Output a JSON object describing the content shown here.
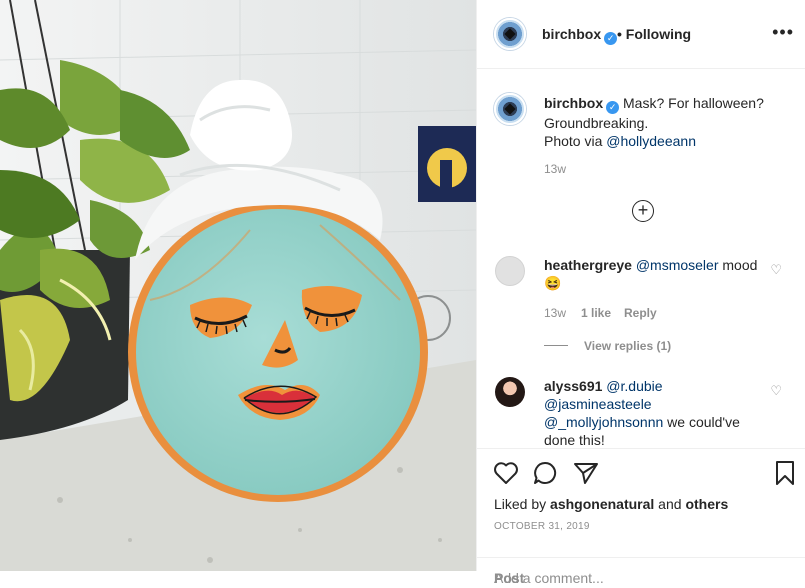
{
  "post": {
    "account": "birchbox",
    "verified_badge": "✓",
    "follow_status": "• Following",
    "more_icon": "more-horizontal-icon",
    "caption_username": "birchbox",
    "caption_text": "Mask? For halloween? Groundbreaking.",
    "caption_credit_prefix": "Photo via ",
    "caption_mention": "@hollydeeann",
    "caption_time": "13w",
    "load_more_icon": "plus-circle-icon",
    "likes_prefix": "Liked by ",
    "likes_user": "ashgonenatural",
    "likes_and": " and ",
    "likes_others": "others",
    "date": "OCTOBER 31, 2019",
    "comment_placeholder": "Add a comment...",
    "post_label": "Post"
  },
  "comments": [
    {
      "username": "heathergreye",
      "mention": "@msmoseler",
      "text": " mood",
      "emoji": "😆",
      "time": "13w",
      "likes": "1 like",
      "reply": "Reply",
      "view_replies": "View replies (1)"
    },
    {
      "username": "alyss691",
      "mention1": "@r.dubie",
      "mention2": "@jasmineasteele",
      "mention3": "@_mollyjohnsonnn",
      "text": " we could've done this!"
    }
  ],
  "colors": {
    "pumpkin_mask": "#9fd8d0",
    "pumpkin_orange": "#f29a4a",
    "link": "#003569",
    "verified": "#3897f0"
  }
}
